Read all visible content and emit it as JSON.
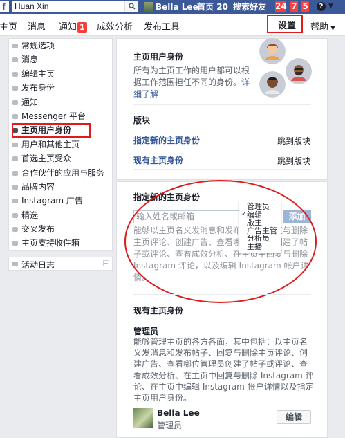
{
  "topbar": {
    "logo": "f",
    "search_value": "Huan  Xin",
    "user_name": "Bella Lee",
    "home_label": "首页",
    "home_count": "20",
    "find_friends": "搜索好友",
    "badges": [
      "24",
      "7",
      "5"
    ],
    "help_icon": "?"
  },
  "pagenav": {
    "items": [
      "主页",
      "消息",
      "通知",
      "成效分析",
      "发布工具"
    ],
    "notif_badge": "1",
    "settings": "设置",
    "help": "帮助"
  },
  "sidebar": {
    "items": [
      "常规选项",
      "消息",
      "编辑主页",
      "发布身份",
      "通知",
      "Messenger 平台",
      "主页用户身份",
      "用户和其他主页",
      "首选主页受众",
      "合作伙伴的应用与服务",
      "品牌内容",
      "Instagram 广告",
      "精选",
      "交叉发布",
      "主页支持收件箱"
    ],
    "activity": "活动日志"
  },
  "roles_intro": {
    "title": "主页用户身份",
    "desc_lines": [
      "所有为主页工作的用户都可以根",
      "据工作范围担任不同的身份。"
    ],
    "learn_more_a": "详",
    "learn_more_b": "细了解"
  },
  "sections": {
    "section_label": "版块",
    "assign_new": "指定新的主页身份",
    "existing": "现有主页身份",
    "jump": "跳到版块"
  },
  "assign": {
    "title": "指定新的主页身份",
    "placeholder": "输入姓名或邮箱",
    "add_button": "添加",
    "role_options": [
      "管理员",
      "编辑",
      "版主",
      "广告主管",
      "分析员",
      "主播"
    ],
    "selected_role": "编辑",
    "desc_lines": [
      "能够以主页名义发消息和发布帖子、回复与删除",
      "主页评论、创建广告、查看哪位管理员创建了帖",
      "子或评论、查看成效分析、在主页中回复与删除",
      "Instagram 评论，以及编辑 Instagram 帐户详",
      "情。"
    ]
  },
  "existing": {
    "title": "现有主页身份",
    "role_title": "管理员",
    "desc_lines": [
      "能够管理主页的各方各面，其中包括：以主页名",
      "义发消息和发布帖子、回复与删除主页评论、创",
      "建广告、查看哪位管理员创建了帖子或评论、查",
      "看成效分析、在主页中回复与删除 Instagram 评",
      "论、在主页中编辑 Instagram 帐户详情以及指定",
      "主页用户身份。"
    ],
    "user_name": "Bella Lee",
    "user_role": "管理员",
    "edit_button": "编辑"
  },
  "colors": {
    "fb_blue": "#3b5998",
    "link_blue": "#365899",
    "badge_red": "#fa3e3e",
    "annotation_red": "#e01b1b"
  }
}
